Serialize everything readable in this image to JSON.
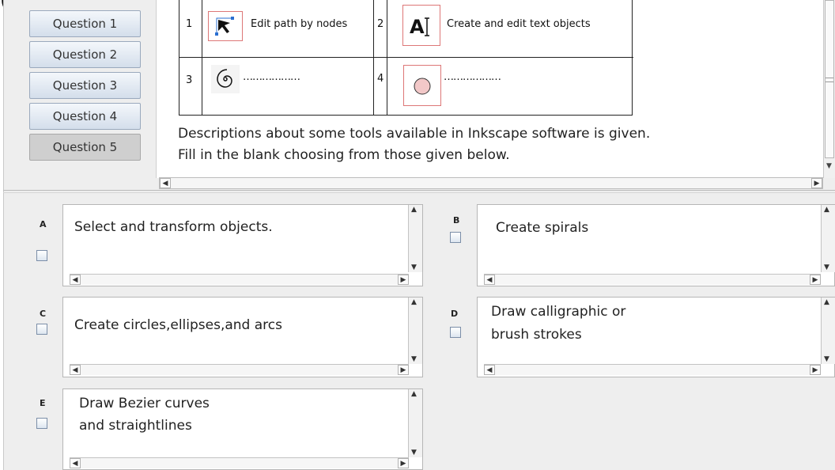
{
  "top_fragment": "(",
  "sidebar": {
    "questions": [
      {
        "label": "Question 1",
        "selected": false
      },
      {
        "label": "Question 2",
        "selected": false
      },
      {
        "label": "Question 3",
        "selected": false
      },
      {
        "label": "Question 4",
        "selected": false
      },
      {
        "label": "Question 5",
        "selected": true
      }
    ]
  },
  "tool_table": {
    "cells": [
      {
        "number": "1",
        "icon": "node-editor-icon",
        "label": "Edit path by nodes"
      },
      {
        "number": "2",
        "icon": "text-tool-icon",
        "label": "Create and edit text objects"
      },
      {
        "number": "3",
        "icon": "spiral-icon",
        "label": "………………"
      },
      {
        "number": "4",
        "icon": "circle-icon",
        "label": "………………"
      }
    ]
  },
  "description": {
    "line1": "Descriptions about some tools available in Inkscape software is given.",
    "line2": "Fill in the blank choosing from those given below."
  },
  "options": [
    {
      "letter": "A",
      "text_lines": [
        "Select and transform objects."
      ],
      "checked": false
    },
    {
      "letter": "B",
      "text_lines": [
        "Create spirals"
      ],
      "checked": false
    },
    {
      "letter": "C",
      "text_lines": [
        "Create circles,ellipses,and arcs"
      ],
      "checked": false
    },
    {
      "letter": "D",
      "text_lines": [
        "Draw calligraphic or",
        "brush strokes"
      ],
      "checked": false
    },
    {
      "letter": "E",
      "text_lines": [
        "Draw Bezier curves",
        "and straightlines"
      ],
      "checked": false
    }
  ],
  "colors": {
    "question_button": "#d4deeb",
    "question_selected": "#cfcfcf",
    "window_bg": "#eeeeee",
    "icon_border": "#dd7777"
  }
}
